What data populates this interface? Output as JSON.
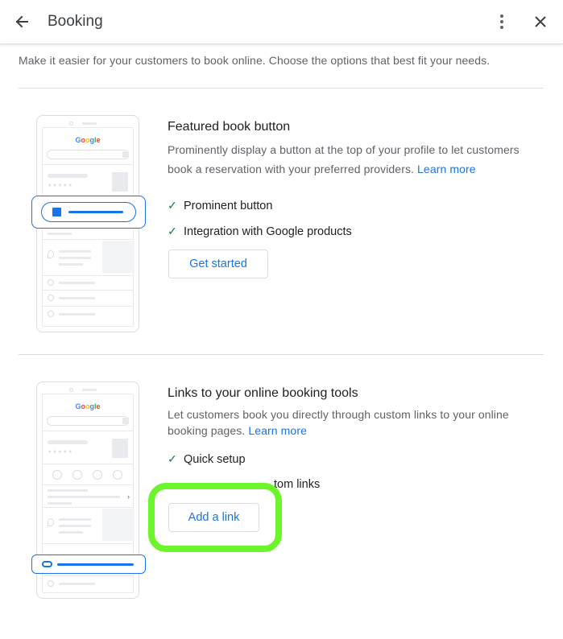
{
  "header": {
    "title": "Booking",
    "back_icon": "arrow-back-icon",
    "more_icon": "more-vert-icon",
    "close_icon": "close-icon"
  },
  "intro": "Make it easier for your customers to book online. Choose the options that best fit your needs.",
  "sections": [
    {
      "title": "Featured book button",
      "description": "Prominently display a button at the top of your profile to let customers book a reservation with your preferred providers.",
      "learn_more": "Learn more",
      "features": [
        "Prominent button",
        "Integration with Google products"
      ],
      "button_label": "Get started",
      "illustration_brand": "Google"
    },
    {
      "title": "Links to your online booking tools",
      "description": "Let customers book you directly through custom links to your online booking pages.",
      "learn_more": "Learn more",
      "features": [
        "Quick setup",
        "tom links"
      ],
      "button_label": "Add a link",
      "illustration_brand": "Google"
    }
  ],
  "colors": {
    "accent": "#1a73e8",
    "check": "#188038",
    "highlight": "#6cf52a",
    "divider": "#dadce0"
  }
}
